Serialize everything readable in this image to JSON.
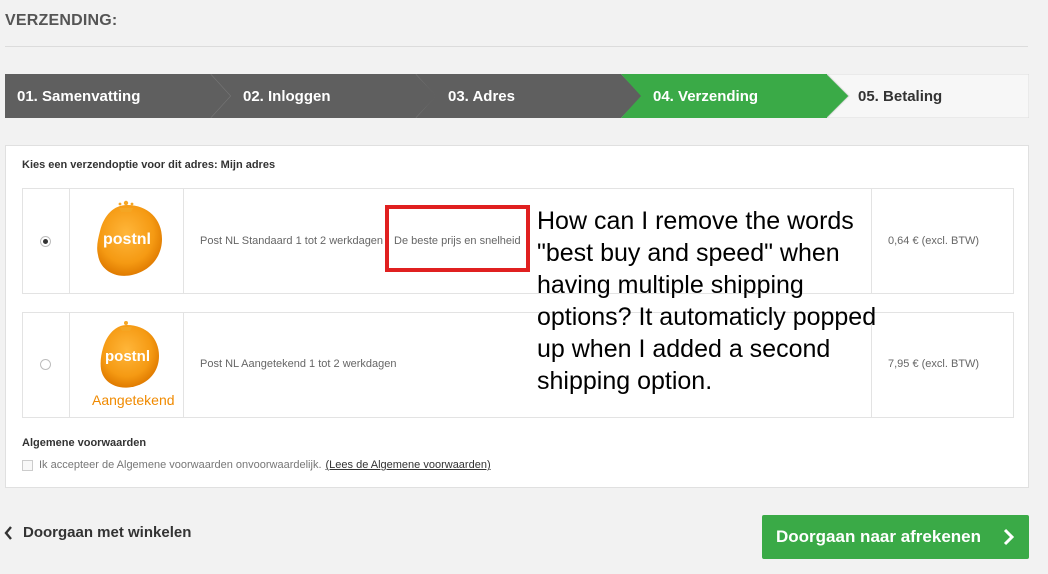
{
  "page": {
    "heading": "VERZENDING:"
  },
  "steps": [
    {
      "label": "01. Samenvatting",
      "state": "done"
    },
    {
      "label": "02. Inloggen",
      "state": "done"
    },
    {
      "label": "03. Adres",
      "state": "done"
    },
    {
      "label": "04. Verzending",
      "state": "active"
    },
    {
      "label": "05. Betaling",
      "state": "upcoming"
    }
  ],
  "colors": {
    "step_done": "#5f5f5f",
    "step_active": "#3aaa47",
    "step_upcoming": "#f5f5f5",
    "checkout_button": "#3aaa47",
    "annotation_box": "#e02020"
  },
  "shipping": {
    "prompt": "Kies een verzendoptie voor dit adres: Mijn adres",
    "options": [
      {
        "logo": "postnl",
        "logo_text": "postnl",
        "logo_sub": "",
        "description": "Post NL Standaard 1 tot 2 werkdagen",
        "tag": "De beste prijs en snelheid",
        "price": "0,64 € (excl. BTW)",
        "selected": true
      },
      {
        "logo": "postnl-aangetekend",
        "logo_text": "postnl",
        "logo_sub": "Aangetekend",
        "description": "Post NL Aangetekend 1 tot 2 werkdagen",
        "tag": "",
        "price": "7,95 € (excl. BTW)",
        "selected": false
      }
    ]
  },
  "terms": {
    "title": "Algemene voorwaarden",
    "accept_text": "Ik accepteer de Algemene voorwaarden onvoorwaardelijk.",
    "link_text": "(Lees de Algemene voorwaarden)",
    "checked": false
  },
  "annotation": {
    "text": "How can I remove the words \"best buy and speed\" when having multiple shipping options? It automaticly popped up when I added a second shipping option."
  },
  "footer": {
    "back_label": "Doorgaan met winkelen",
    "checkout_label": "Doorgaan naar afrekenen"
  },
  "icons": {
    "back": "chevron-left-icon",
    "checkout": "chevron-right-icon",
    "logo": "postnl-logo"
  }
}
